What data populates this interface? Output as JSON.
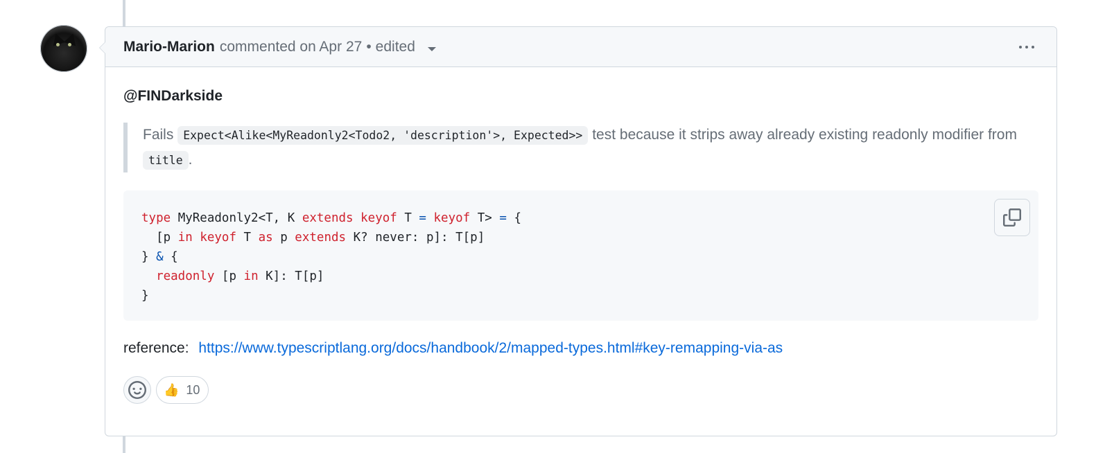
{
  "comment": {
    "author": "Mario-Marion",
    "action": "commented on Apr 27",
    "separator": "•",
    "edited_label": "edited",
    "mention": "@FINDarkside",
    "quote": {
      "prefix": "Fails",
      "code1": "Expect<Alike<MyReadonly2<Todo2, 'description'>, Expected>>",
      "middle": "test because it strips away already existing readonly modifier from",
      "code2": "title",
      "suffix": "."
    },
    "reference": {
      "label": "reference:",
      "url": "https://www.typescriptlang.org/docs/handbook/2/mapped-types.html#key-remapping-via-as"
    },
    "reactions": [
      {
        "emoji": "👍",
        "count": "10"
      }
    ]
  },
  "code": {
    "language": "typescript",
    "lines": [
      "type MyReadonly2<T, K extends keyof T = keyof T> = {",
      "  [p in keyof T as p extends K? never: p]: T[p]",
      "} & {",
      "  readonly [p in K]: T[p]",
      "}"
    ]
  },
  "icons": {
    "menu": "kebab-icon",
    "copy": "copy-icon",
    "reaction_add": "smiley-icon",
    "dropdown": "caret-down-icon"
  },
  "colors": {
    "keyword": "#cf222e",
    "operator": "#0550ae",
    "link": "#0969da",
    "border": "#d0d7de"
  }
}
